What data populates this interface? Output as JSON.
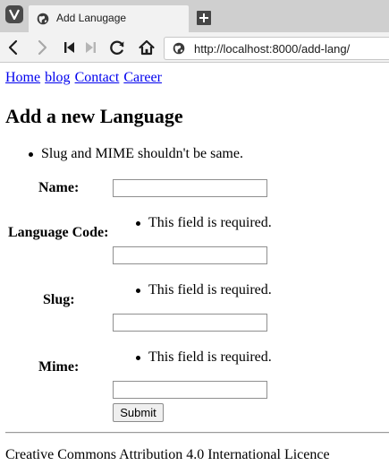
{
  "browser": {
    "tab_title": "Add Lanugage",
    "url": "http://localhost:8000/add-lang/"
  },
  "nav": {
    "links": [
      "Home",
      "blog",
      "Contact",
      "Career"
    ]
  },
  "page": {
    "title": "Add a new Language",
    "notes": [
      "Slug and MIME shouldn't be same."
    ]
  },
  "form": {
    "fields": [
      {
        "label": "Name:",
        "value": "",
        "error": ""
      },
      {
        "label": "Language Code:",
        "value": "",
        "error": "This field is required."
      },
      {
        "label": "Slug:",
        "value": "",
        "error": "This field is required."
      },
      {
        "label": "Mime:",
        "value": "",
        "error": "This field is required."
      }
    ],
    "submit_label": "Submit"
  },
  "footer": {
    "text": "Creative Commons Attribution 4.0 International Licence"
  },
  "colors": {
    "link": "#0000ee",
    "tabbar": "#cfcfcf",
    "toolbar": "#f2f2f2"
  }
}
